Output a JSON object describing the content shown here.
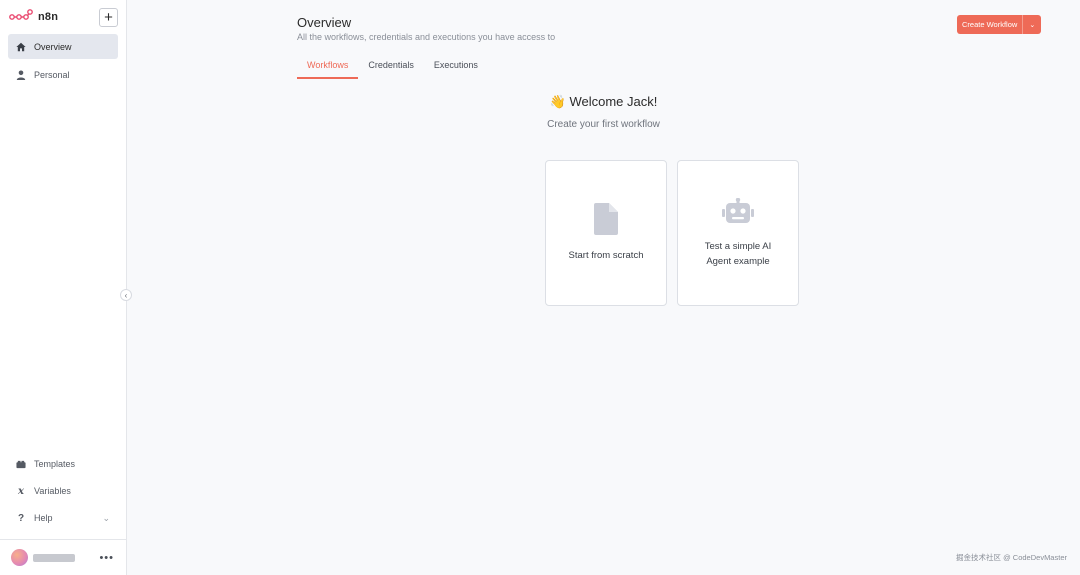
{
  "sidebar": {
    "brand": "n8n",
    "new_button": "+",
    "nav": [
      {
        "label": "Overview",
        "icon": "home-icon"
      },
      {
        "label": "Personal",
        "icon": "user-icon"
      }
    ],
    "bottom": [
      {
        "label": "Templates",
        "icon": "templates-icon"
      },
      {
        "label": "Variables",
        "icon": "variables-icon"
      },
      {
        "label": "Help",
        "icon": "help-icon"
      }
    ],
    "more": "•••"
  },
  "header": {
    "title": "Overview",
    "subtitle": "All the workflows, credentials and executions you have access to",
    "create_button": "Create Workflow"
  },
  "tabs": [
    {
      "label": "Workflows"
    },
    {
      "label": "Credentials"
    },
    {
      "label": "Executions"
    }
  ],
  "welcome": {
    "emoji": "👋",
    "title": "Welcome Jack!",
    "subtitle": "Create your first workflow"
  },
  "cards": [
    {
      "label": "Start from scratch",
      "icon": "file-icon"
    },
    {
      "label": "Test a simple AI Agent example",
      "icon": "robot-icon"
    }
  ],
  "watermark": "掘金技术社区 @ CodeDevMaster",
  "colors": {
    "accent": "#ee6a57",
    "brand": "#ea4b71",
    "sidebar_active": "#e4e7ee"
  }
}
